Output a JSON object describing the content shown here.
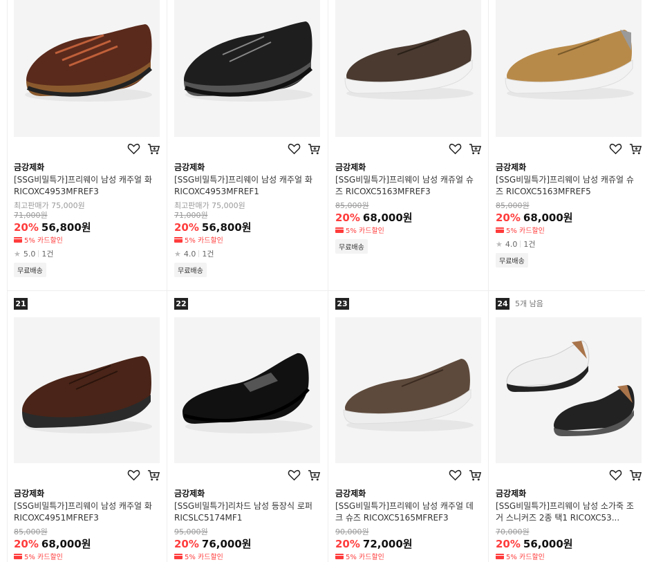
{
  "colors": {
    "accent": "#ff3c3c",
    "text": "#222222",
    "muted": "#999999"
  },
  "row1": [
    {
      "brand": "금강제화",
      "title": "[SSG비밀특가]프리웨이 남성 캐주얼 화 RICOXC4953MFREF3",
      "highest_price_label": "최고판매가 75,000원",
      "original_price": "71,000원",
      "discount": "20%",
      "price": "56,800원",
      "card_discount": "5% 카드할인",
      "rating": "5.0",
      "reviews": "1건",
      "tag": "무료배송",
      "shoe_color": "#5a2a1c",
      "sole_color": "#8a5a2e"
    },
    {
      "brand": "금강제화",
      "title": "[SSG비밀특가]프리웨이 남성 캐주얼 화 RICOXC4953MFREF1",
      "highest_price_label": "최고판매가 75,000원",
      "original_price": "71,000원",
      "discount": "20%",
      "price": "56,800원",
      "card_discount": "5% 카드할인",
      "rating": "4.0",
      "reviews": "1건",
      "tag": "무료배송",
      "shoe_color": "#1e1e1e",
      "sole_color": "#555555"
    },
    {
      "brand": "금강제화",
      "title": "[SSG비밀특가]프리웨이 남성 캐쥬얼 슈즈 RICOXC5163MFREF3",
      "original_price": "85,000원",
      "discount": "20%",
      "price": "68,000원",
      "card_discount": "5% 카드할인",
      "tag": "무료배송",
      "shoe_color": "#4a3a30",
      "sole_color": "#f2f2f2"
    },
    {
      "brand": "금강제화",
      "title": "[SSG비밀특가]프리웨이 남성 캐쥬얼 슈즈 RICOXC5163MFREF5",
      "original_price": "85,000원",
      "discount": "20%",
      "price": "68,000원",
      "card_discount": "5% 카드할인",
      "rating": "4.0",
      "reviews": "1건",
      "tag": "무료배송",
      "shoe_color": "#b88a4a",
      "sole_color": "#f2f2f2"
    }
  ],
  "row2": [
    {
      "rank": "21",
      "brand": "금강제화",
      "title": "[SSG비밀특가]프리웨이 남성 캐주얼 화 RICOXC4951MFREF3",
      "original_price": "85,000원",
      "discount": "20%",
      "price": "68,000원",
      "card_discount": "5% 카드할인",
      "shoe_color": "#4a2418",
      "sole_color": "#2a2a2a"
    },
    {
      "rank": "22",
      "brand": "금강제화",
      "title": "[SSG비밀특가]리차드 남성 등장식 로퍼 RICSLC5174MF1",
      "original_price": "95,000원",
      "discount": "20%",
      "price": "76,000원",
      "card_discount": "5% 카드할인",
      "shoe_color": "#111111",
      "sole_color": "#111111"
    },
    {
      "rank": "23",
      "brand": "금강제화",
      "title": "[SSG비밀특가]프리웨이 남성 캐주얼 데크 슈즈 RICOXC5165MFREF3",
      "original_price": "90,000원",
      "discount": "20%",
      "price": "72,000원",
      "card_discount": "5% 카드할인",
      "shoe_color": "#5e4a3c",
      "sole_color": "#eeeeee"
    },
    {
      "rank": "24",
      "stock": "5개 남음",
      "brand": "금강제화",
      "title": "[SSG비밀특가]프리웨이 남성 소가죽 조거 스니커즈 2종 택1 RICOXC53...",
      "original_price": "70,000원",
      "discount": "20%",
      "price": "56,000원",
      "card_discount": "5% 카드할인",
      "shoe_color": "#f0f0f0",
      "sole_color": "#222222"
    }
  ]
}
